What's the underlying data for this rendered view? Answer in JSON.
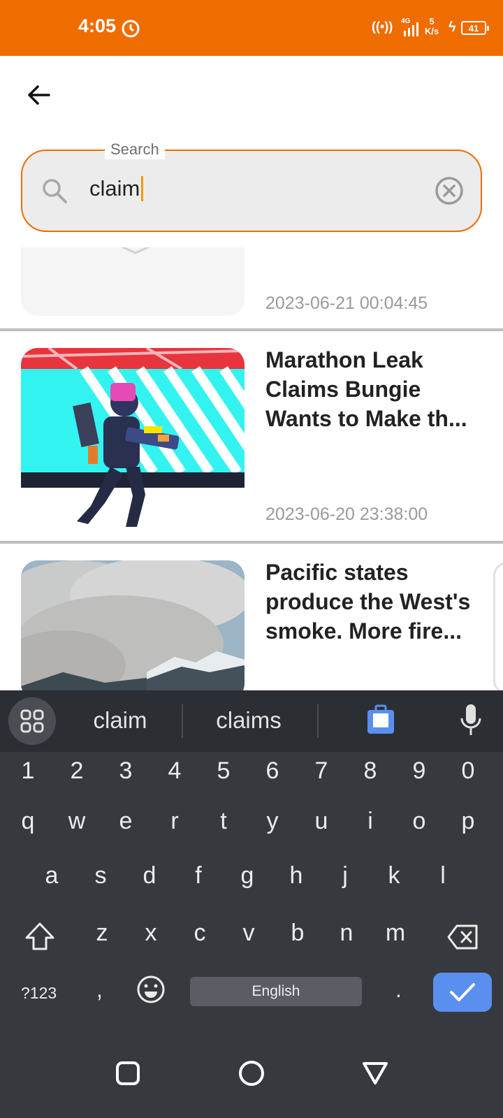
{
  "status_bar": {
    "time": "4:05",
    "network": "4G",
    "speed_value": "5",
    "speed_unit": "K/s",
    "battery": "41",
    "bg_color": "#EF6C00"
  },
  "search": {
    "label": "Search",
    "value": "claim",
    "accent_color": "#EF6C00"
  },
  "news": [
    {
      "title": "",
      "date": "2023-06-21 00:04:45"
    },
    {
      "title": "Marathon Leak Claims Bungie Wants to Make th...",
      "date": "2023-06-20 23:38:00"
    },
    {
      "title": "Pacific states produce the West's smoke. More fire...",
      "date": ""
    }
  ],
  "keyboard": {
    "suggestions": [
      "claim",
      "claims"
    ],
    "number_row": [
      "1",
      "2",
      "3",
      "4",
      "5",
      "6",
      "7",
      "8",
      "9",
      "0"
    ],
    "row1": [
      "q",
      "w",
      "e",
      "r",
      "t",
      "y",
      "u",
      "i",
      "o",
      "p"
    ],
    "row2": [
      "a",
      "s",
      "d",
      "f",
      "g",
      "h",
      "j",
      "k",
      "l"
    ],
    "row3": [
      "z",
      "x",
      "c",
      "v",
      "b",
      "n",
      "m"
    ],
    "symbols_label": "?123",
    "comma": ",",
    "space_label": "English",
    "period": ".",
    "enter_color": "#5B8FEF"
  }
}
